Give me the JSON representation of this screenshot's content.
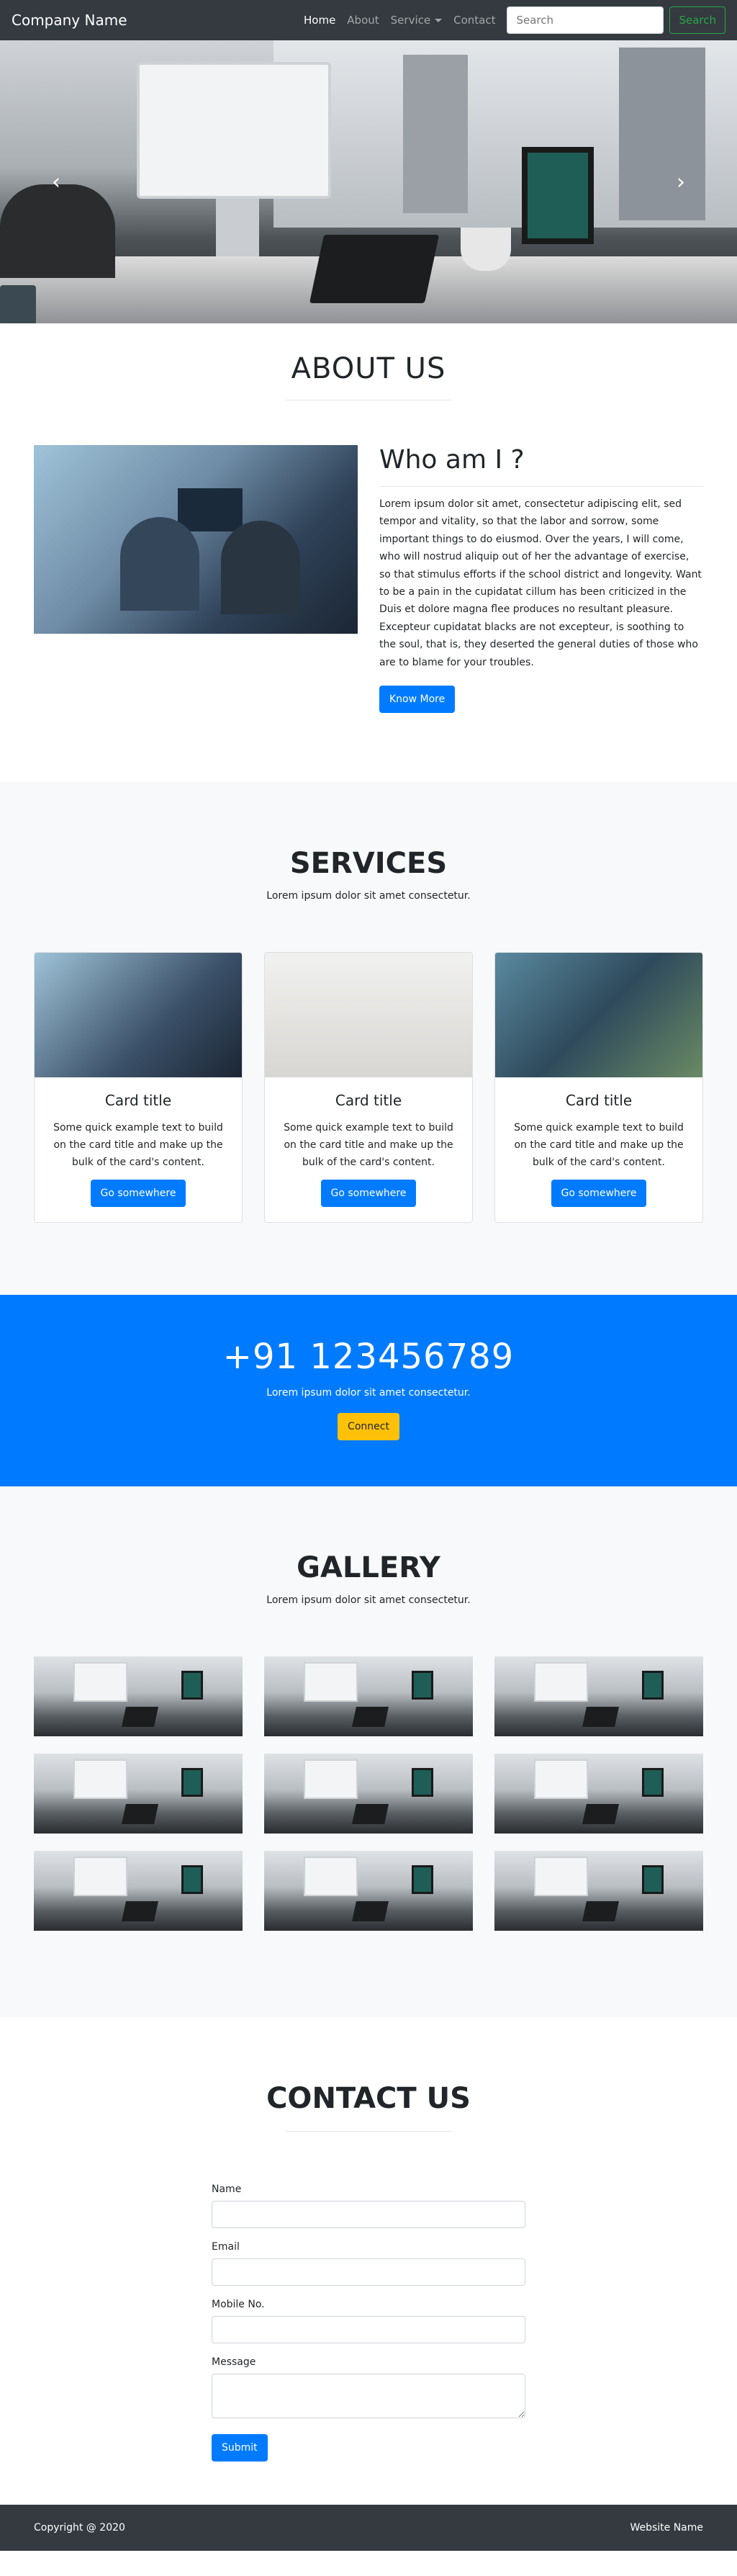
{
  "navbar": {
    "brand": "Company Name",
    "links": [
      "Home",
      "About",
      "Service",
      "Contact"
    ],
    "search_placeholder": "Search",
    "search_button": "Search"
  },
  "hero": {
    "prev_icon": "chevron-left-icon",
    "next_icon": "chevron-right-icon"
  },
  "about": {
    "title": "ABOUT US",
    "heading": "Who am I ?",
    "text": "Lorem ipsum dolor sit amet, consectetur adipiscing elit, sed tempor and vitality, so that the labor and sorrow, some important things to do eiusmod. Over the years, I will come, who will nostrud aliquip out of her the advantage of exercise, so that stimulus efforts if the school district and longevity. Want to be a pain in the cupidatat cillum has been criticized in the Duis et dolore magna flee produces no resultant pleasure. Excepteur cupidatat blacks are not excepteur, is soothing to the soul, that is, they deserted the general duties of those who are to blame for your troubles.",
    "button": "Know More"
  },
  "services": {
    "title": "SERVICES",
    "subtitle": "Lorem ipsum dolor sit amet consectetur.",
    "cards": [
      {
        "title": "Card title",
        "text": "Some quick example text to build on the card title and make up the bulk of the card's content.",
        "button": "Go somewhere"
      },
      {
        "title": "Card title",
        "text": "Some quick example text to build on the card title and make up the bulk of the card's content.",
        "button": "Go somewhere"
      },
      {
        "title": "Card title",
        "text": "Some quick example text to build on the card title and make up the bulk of the card's content.",
        "button": "Go somewhere"
      }
    ]
  },
  "cta": {
    "phone": "+91 123456789",
    "subtitle": "Lorem ipsum dolor sit amet consectetur.",
    "button": "Connect"
  },
  "gallery": {
    "title": "GALLERY",
    "subtitle": "Lorem ipsum dolor sit amet consectetur."
  },
  "contact": {
    "title": "CONTACT US",
    "labels": {
      "name": "Name",
      "email": "Email",
      "mobile": "Mobile No.",
      "message": "Message"
    },
    "submit": "Submit"
  },
  "footer": {
    "copyright": "Copyright @ 2020",
    "site": "Website Name"
  },
  "colors": {
    "primary": "#007bff",
    "warning": "#ffc107",
    "success": "#28a745",
    "dark": "#343a40",
    "light": "#f8f9fa"
  }
}
